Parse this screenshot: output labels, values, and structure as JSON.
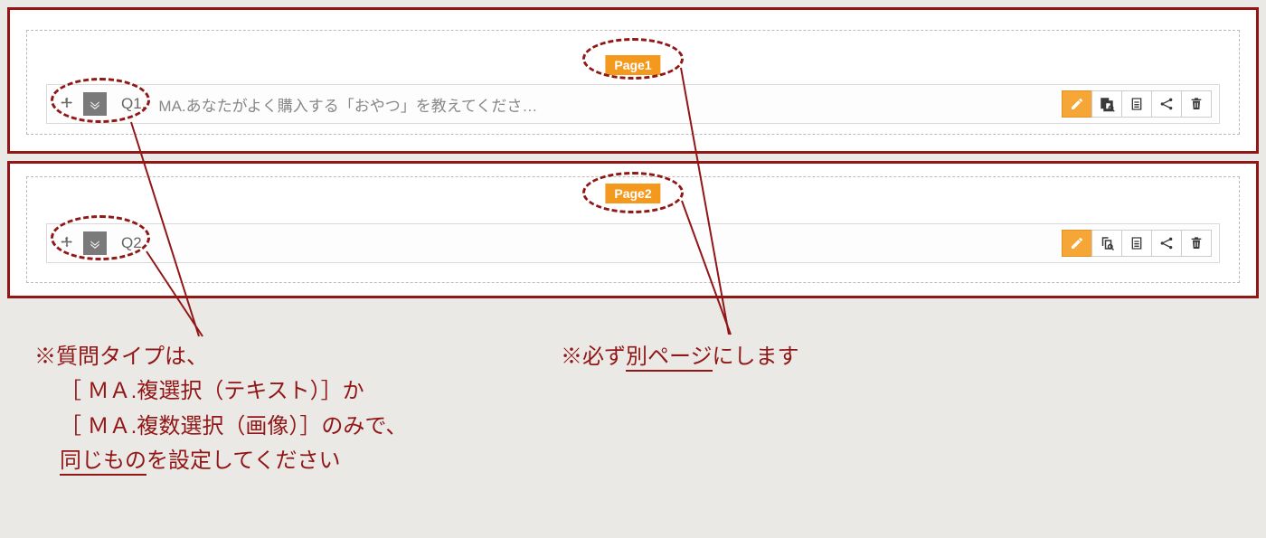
{
  "pages": [
    {
      "badge": "Page1",
      "qnum": "Q1.",
      "qtext": "MA.あなたがよく購入する「おやつ」を教えてくださ…"
    },
    {
      "badge": "Page2",
      "qnum": "Q2.",
      "qtext": ""
    }
  ],
  "icons": {
    "edit": "edit",
    "preview": "preview",
    "memo": "memo",
    "branch": "branch",
    "delete": "delete"
  },
  "notes": {
    "left_prefix": "※",
    "left_l1": "質問タイプは、",
    "left_l2": "［ ＭＡ.複選択（テキスト）］か",
    "left_l3": "［ ＭＡ.複数選択（画像）］のみで、",
    "left_l4_u": "同じもの",
    "left_l4_rest": "を設定してください",
    "right_prefix": "※",
    "right_pre": "必ず",
    "right_u": "別ページ",
    "right_post": "にします"
  }
}
